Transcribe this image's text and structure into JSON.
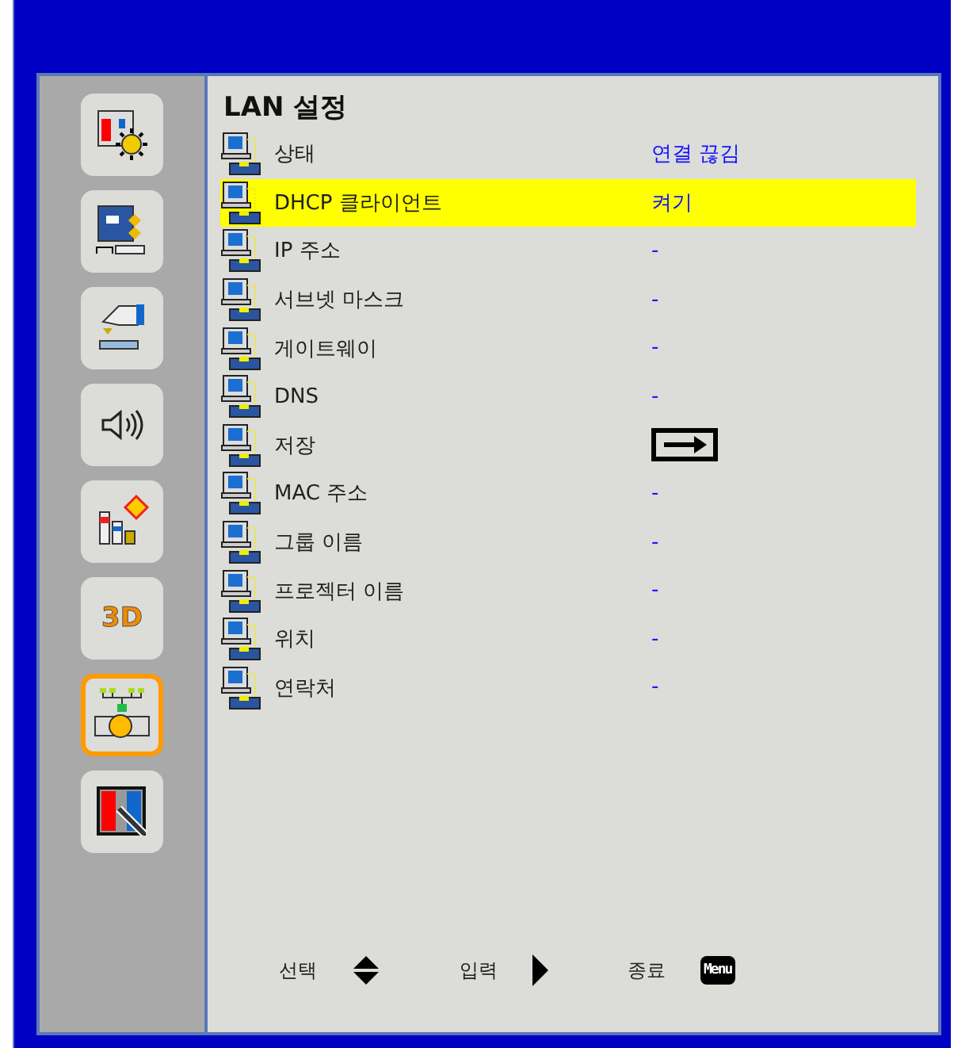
{
  "sidebar": [
    {
      "kind": "image",
      "selected": false
    },
    {
      "kind": "display",
      "selected": false
    },
    {
      "kind": "setup",
      "selected": false
    },
    {
      "kind": "volume",
      "selected": false
    },
    {
      "kind": "info",
      "selected": false
    },
    {
      "kind": "stereo",
      "label": "3D",
      "selected": false
    },
    {
      "kind": "network",
      "selected": true
    },
    {
      "kind": "whiteboard",
      "selected": false
    }
  ],
  "panel": {
    "title": "LAN 설정",
    "rows": [
      {
        "label": "상태",
        "kind": "text",
        "value": "연결 끊김",
        "selected": false
      },
      {
        "label": "DHCP 클라이언트",
        "kind": "text",
        "value": "켜기",
        "selected": true
      },
      {
        "label": "IP 주소",
        "kind": "text",
        "value": "-",
        "selected": false
      },
      {
        "label": "서브넷 마스크",
        "kind": "text",
        "value": "-",
        "selected": false
      },
      {
        "label": "게이트웨이",
        "kind": "text",
        "value": "-",
        "selected": false
      },
      {
        "label": "DNS",
        "kind": "text",
        "value": "-",
        "selected": false
      },
      {
        "label": "저장",
        "kind": "button",
        "selected": false
      },
      {
        "label": "MAC 주소",
        "kind": "text",
        "value": "-",
        "selected": false
      },
      {
        "label": "그룹 이름",
        "kind": "text",
        "value": "-",
        "selected": false
      },
      {
        "label": "프로젝터 이름",
        "kind": "text",
        "value": "-",
        "selected": false
      },
      {
        "label": "위치",
        "kind": "text",
        "value": "-",
        "selected": false
      },
      {
        "label": "연락처",
        "kind": "text",
        "value": "-",
        "selected": false
      }
    ]
  },
  "footer": [
    {
      "label": "선택",
      "kind": "updown"
    },
    {
      "label": "입력",
      "kind": "enter"
    },
    {
      "label": "종료",
      "kind": "exit",
      "key_label": "Menu"
    }
  ]
}
